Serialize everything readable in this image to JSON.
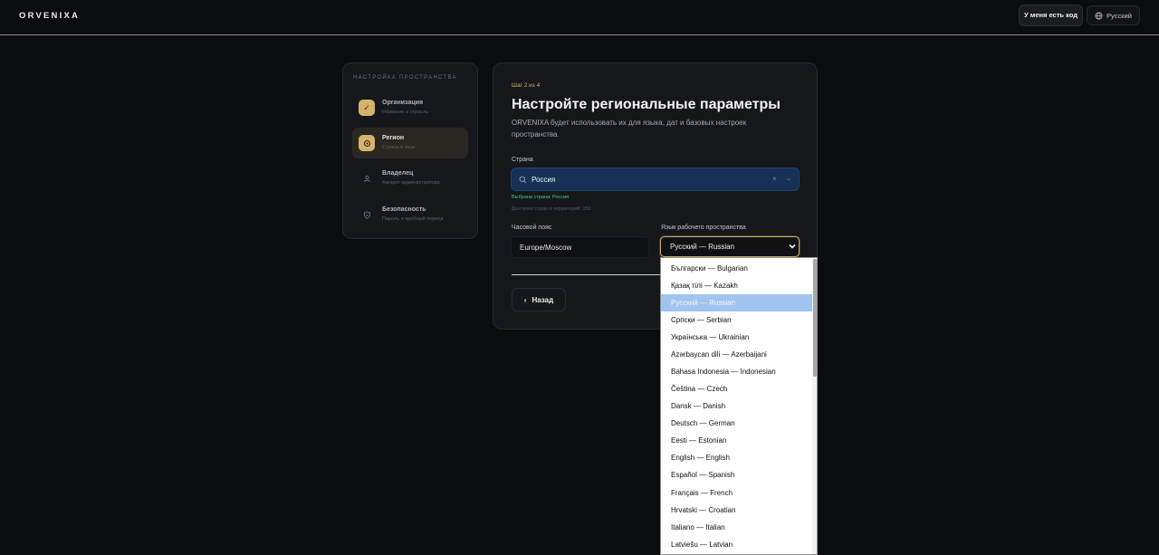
{
  "header": {
    "logo": "ORVENIXA",
    "have_code": "У меня есть код",
    "language": "Русский"
  },
  "sidebar": {
    "title": "НАСТРОЙКА ПРОСТРАНСТВА",
    "items": [
      {
        "name": "Организация",
        "sub": "Название и отрасль",
        "icon": "check-icon",
        "state": "done"
      },
      {
        "name": "Регион",
        "sub": "Страна и язык",
        "icon": "circle-icon",
        "state": "active"
      },
      {
        "name": "Владелец",
        "sub": "Аккаунт администратора",
        "icon": "user-icon",
        "state": "pending"
      },
      {
        "name": "Безопасность",
        "sub": "Пароль и пробный период",
        "icon": "shield-icon",
        "state": "pending"
      }
    ]
  },
  "main": {
    "step": "Шаг 2 из 4",
    "title": "Настройте региональные параметры",
    "description": "ORVENIXA будет использовать их для языка, дат и базовых настроек пространства.",
    "country_label": "Страна",
    "country_value": "Россия",
    "country_selected_hint": "Выбрана страна: Россия",
    "country_count_hint": "Доступно стран и территорий: 250",
    "timezone_label": "Часовой пояс",
    "timezone_value": "Europe/Moscow",
    "workspace_lang_label": "Язык рабочего пространства",
    "workspace_lang_value": "Русский — Russian",
    "back": "Назад"
  },
  "dropdown": {
    "options": [
      "Български — Bulgarian",
      "Қазақ тілі — Kazakh",
      "Русский — Russian",
      "Српски — Serbian",
      "Українська — Ukrainian",
      "Azərbaycan dili — Azerbaijani",
      "Bahasa Indonesia — Indonesian",
      "Čeština — Czech",
      "Dansk — Danish",
      "Deutsch — German",
      "Eesti — Estonian",
      "English — English",
      "Español — Spanish",
      "Français — French",
      "Hrvatski — Croatian",
      "Italiano — Italian",
      "Latviešu — Latvian"
    ],
    "selected_index": 2
  },
  "colors": {
    "accent_gold": "#d6b36c",
    "success": "#3fd18a",
    "country_field": "#163155",
    "option_highlight": "#9fc4f0"
  }
}
